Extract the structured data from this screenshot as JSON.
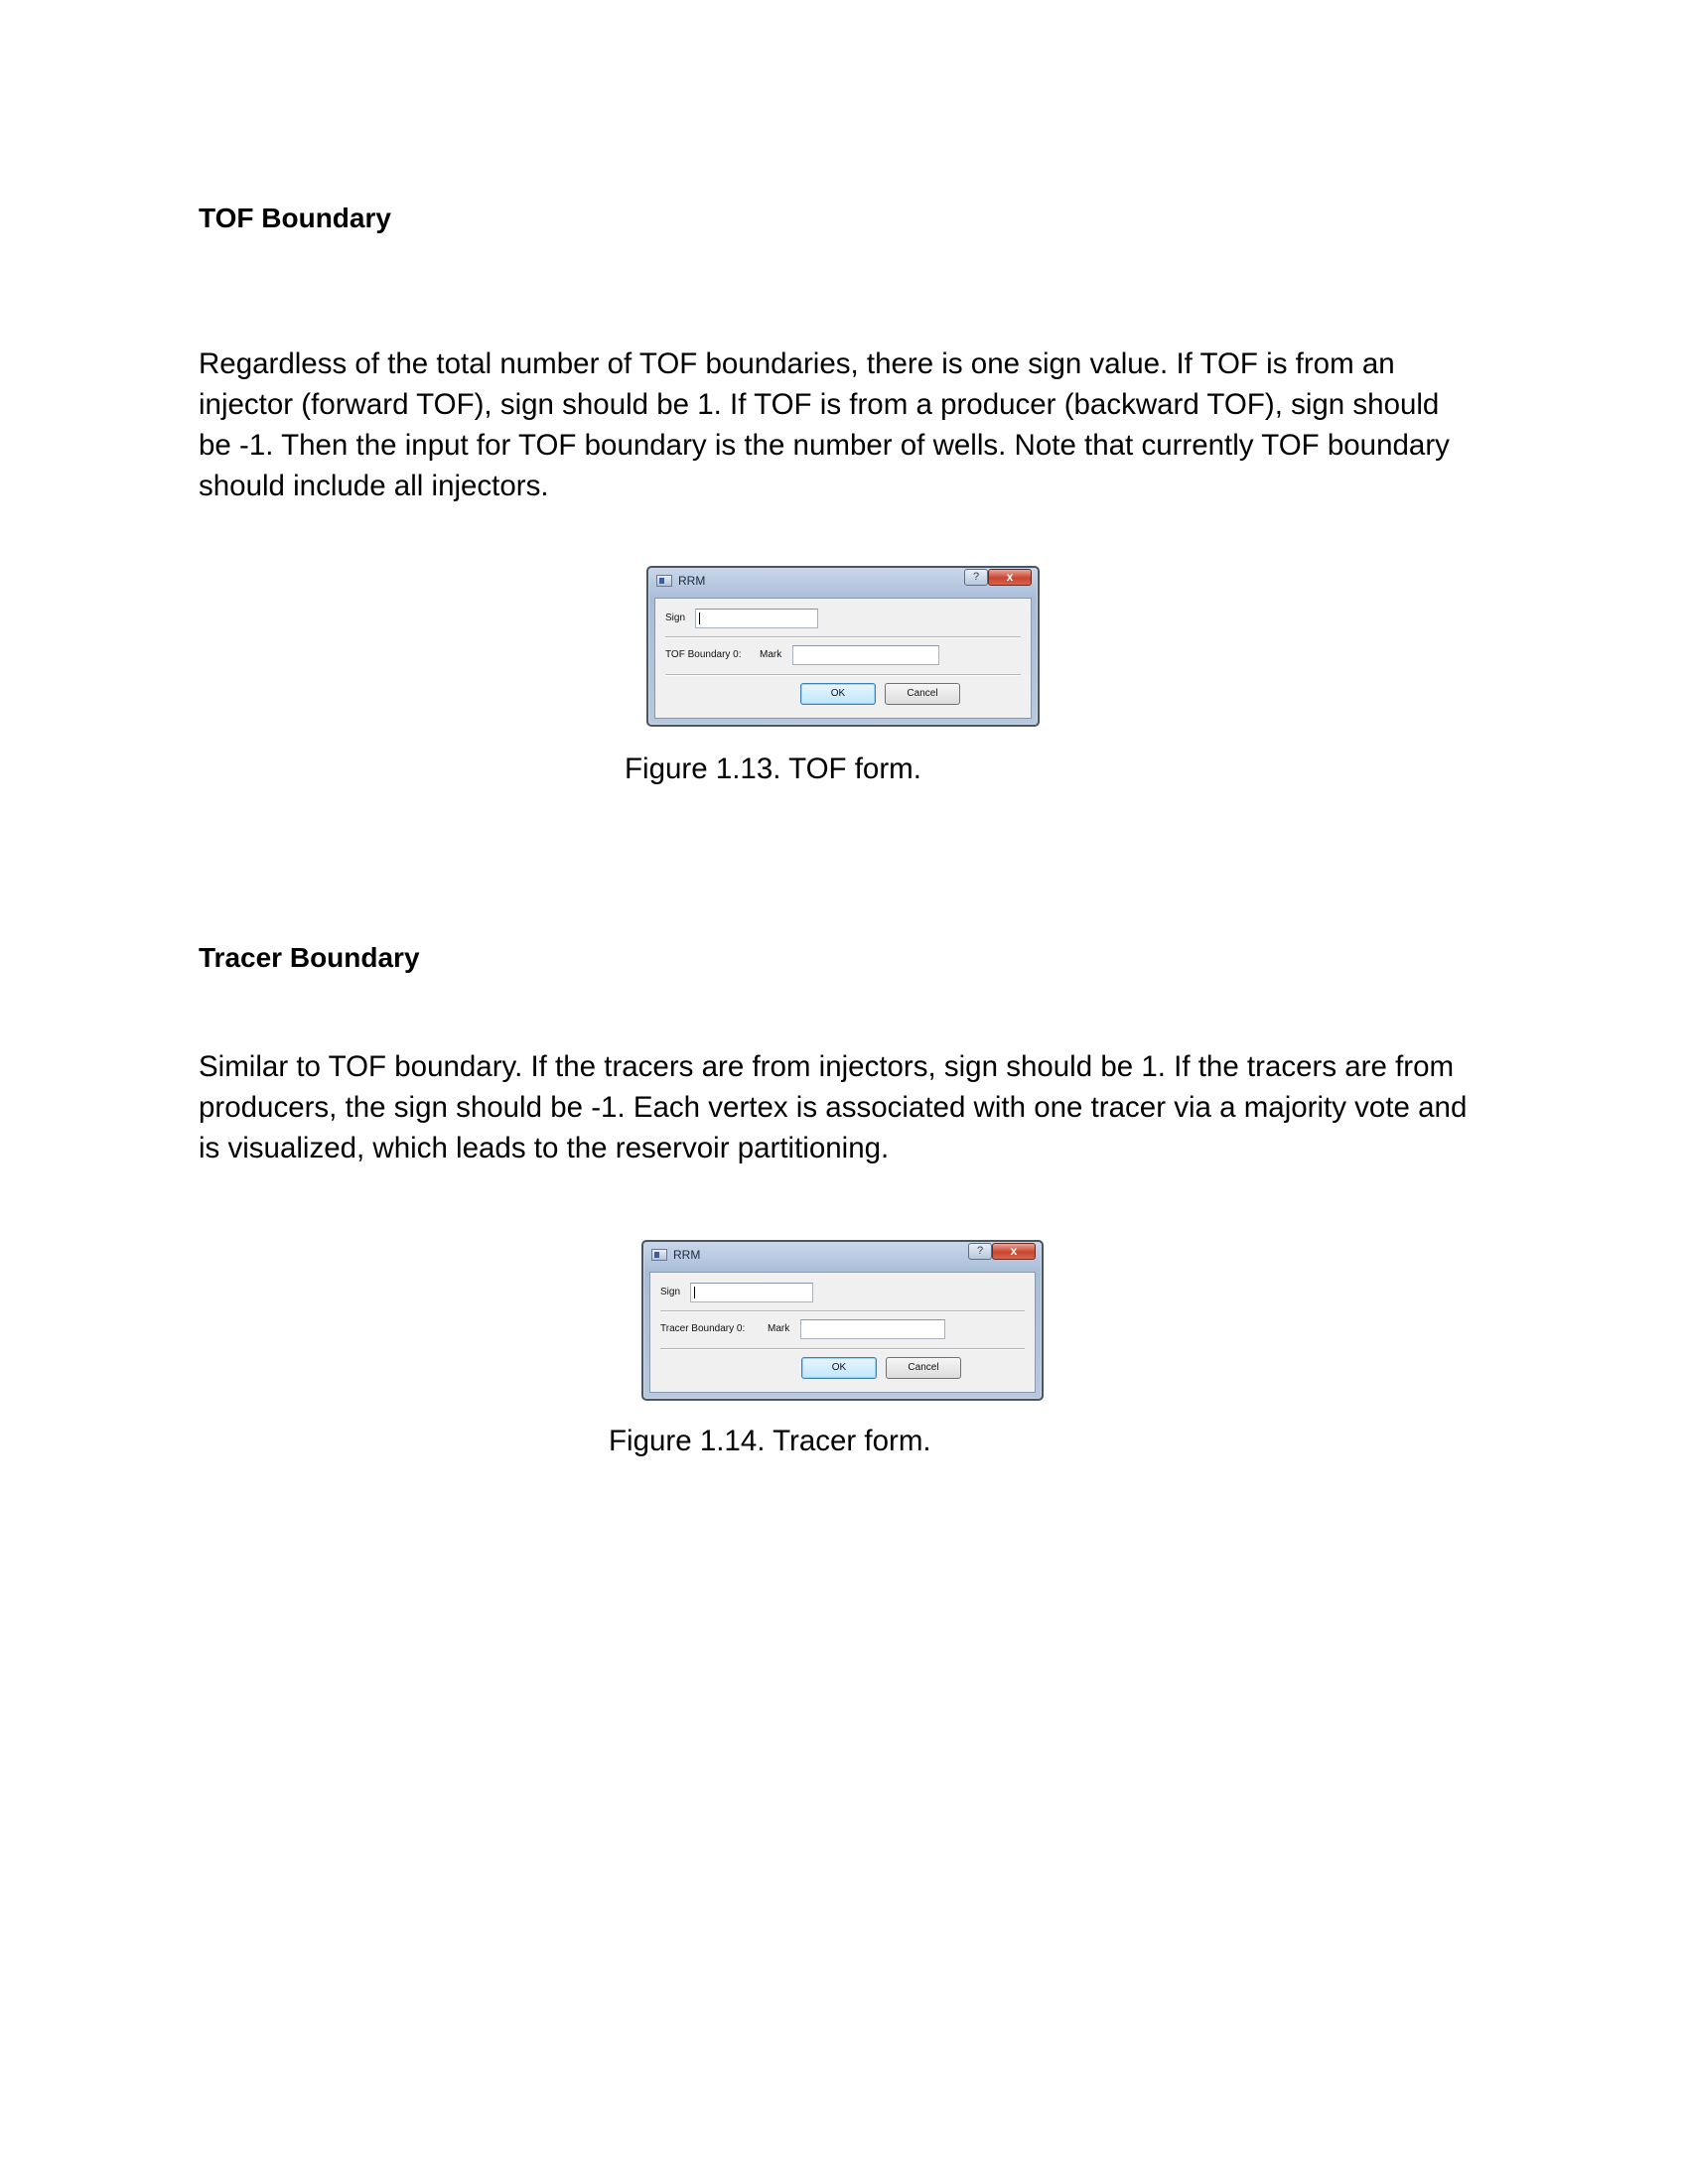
{
  "sections": [
    {
      "heading": "TOF Boundary",
      "paragraph": "Regardless of the total number of TOF boundaries, there is one sign value. If TOF is from an injector (forward TOF), sign should be 1. If TOF is from a producer (backward TOF), sign should be -1. Then the input for TOF boundary is the number of wells. Note that currently TOF boundary should include all injectors.",
      "dialog": {
        "title": "RRM",
        "help_label": "?",
        "close_label": "x",
        "sign_label": "Sign",
        "sign_value": "",
        "boundary_label": "TOF Boundary 0:",
        "mark_label": "Mark",
        "mark_value": "",
        "ok_label": "OK",
        "cancel_label": "Cancel"
      },
      "caption": "Figure 1.13. TOF form."
    },
    {
      "heading": "Tracer Boundary",
      "paragraph": "Similar to TOF boundary. If the tracers are from injectors, sign should be 1. If the tracers are from producers, the sign should be -1. Each vertex is associated with one tracer via a majority vote and is visualized, which leads to the reservoir partitioning.",
      "dialog": {
        "title": "RRM",
        "help_label": "?",
        "close_label": "x",
        "sign_label": "Sign",
        "sign_value": "",
        "boundary_label": "Tracer Boundary 0:",
        "mark_label": "Mark",
        "mark_value": "",
        "ok_label": "OK",
        "cancel_label": "Cancel"
      },
      "caption": "Figure 1.14. Tracer form."
    }
  ]
}
